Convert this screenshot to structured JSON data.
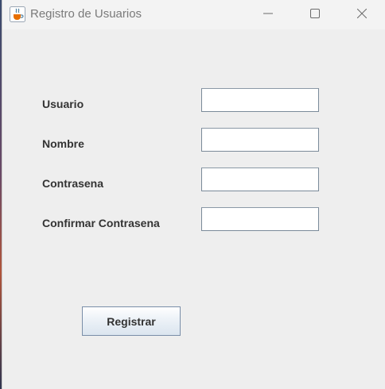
{
  "window": {
    "title": "Registro de Usuarios",
    "icon": "java-cup-icon",
    "controls": {
      "minimize": "minimize-icon",
      "maximize": "maximize-icon",
      "close": "close-icon"
    }
  },
  "form": {
    "fields": [
      {
        "label": "Usuario",
        "value": ""
      },
      {
        "label": "Nombre",
        "value": ""
      },
      {
        "label": "Contrasena",
        "value": ""
      },
      {
        "label": "Confirmar Contrasena",
        "value": ""
      }
    ],
    "submit_label": "Registrar"
  },
  "colors": {
    "window_background": "#eeeeee",
    "titlebar_background": "#f3f3f3",
    "label_text": "#333333",
    "field_border": "#7a8a99"
  }
}
